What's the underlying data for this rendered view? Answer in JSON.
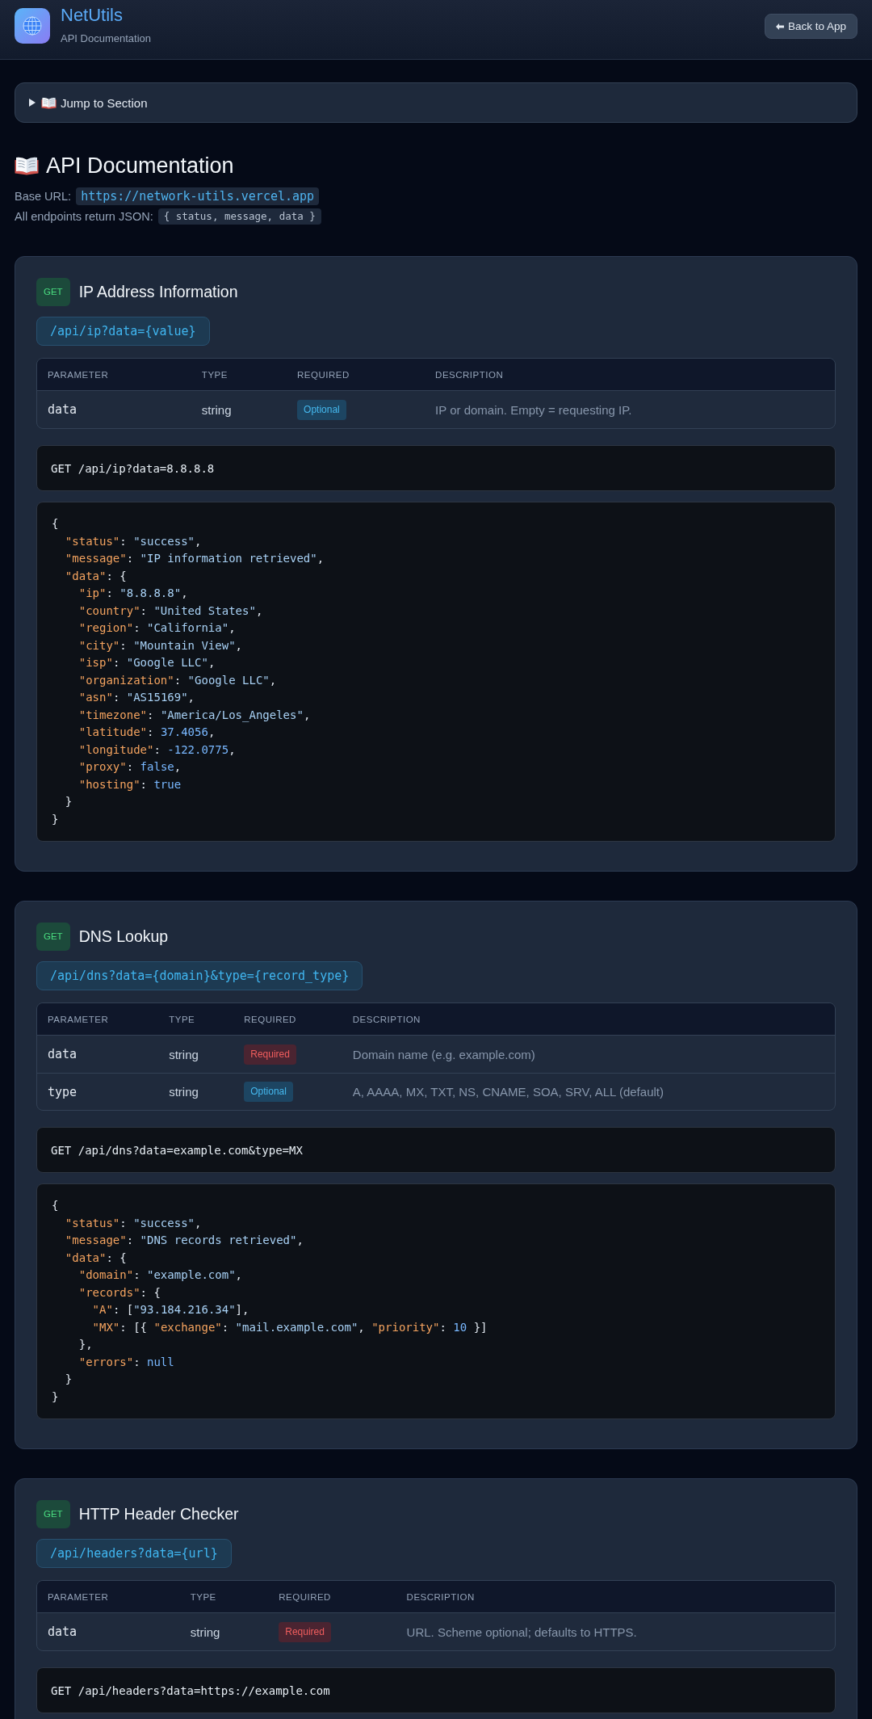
{
  "header": {
    "title": "NetUtils",
    "subtitle": "API Documentation",
    "back_button": "Back to App"
  },
  "jump_to_section": {
    "label": "Jump to Section",
    "expanded": false
  },
  "intro": {
    "title": "API Documentation",
    "base_url_label": "Base URL:",
    "base_url": "https://network-utils.vercel.app",
    "json_note_label": "All endpoints return JSON:",
    "json_shape": "{ status, message, data }"
  },
  "endpoints": [
    {
      "method": "GET",
      "title": "IP Address Information",
      "path": "/api/ip?data={value}",
      "params_table": {
        "columns": [
          "PARAMETER",
          "TYPE",
          "REQUIRED",
          "DESCRIPTION"
        ],
        "rows": [
          {
            "name": "data",
            "type": "string",
            "required": false,
            "badge": "Optional",
            "description": "IP or domain. Empty = requesting IP."
          }
        ]
      },
      "example_request": "GET /api/ip?data=8.8.8.8",
      "example_response": [
        "{",
        "  \"status\": \"success\",",
        "  \"message\": \"IP information retrieved\",",
        "  \"data\": {",
        "    \"ip\": \"8.8.8.8\",",
        "    \"country\": \"United States\",",
        "    \"region\": \"California\",",
        "    \"city\": \"Mountain View\",",
        "    \"isp\": \"Google LLC\",",
        "    \"organization\": \"Google LLC\",",
        "    \"asn\": \"AS15169\",",
        "    \"timezone\": \"America/Los_Angeles\",",
        "    \"latitude\": 37.4056,",
        "    \"longitude\": -122.0775,",
        "    \"proxy\": false,",
        "    \"hosting\": true",
        "  }",
        "}"
      ]
    },
    {
      "method": "GET",
      "title": "DNS Lookup",
      "path": "/api/dns?data={domain}&type={record_type}",
      "params_table": {
        "columns": [
          "PARAMETER",
          "TYPE",
          "REQUIRED",
          "DESCRIPTION"
        ],
        "rows": [
          {
            "name": "data",
            "type": "string",
            "required": true,
            "badge": "Required",
            "description": "Domain name (e.g. example.com)"
          },
          {
            "name": "type",
            "type": "string",
            "required": false,
            "badge": "Optional",
            "description": "A, AAAA, MX, TXT, NS, CNAME, SOA, SRV, ALL (default)"
          }
        ]
      },
      "example_request": "GET /api/dns?data=example.com&type=MX",
      "example_response": [
        "{",
        "  \"status\": \"success\",",
        "  \"message\": \"DNS records retrieved\",",
        "  \"data\": {",
        "    \"domain\": \"example.com\",",
        "    \"records\": {",
        "      \"A\": [\"93.184.216.34\"],",
        "      \"MX\": [{ \"exchange\": \"mail.example.com\", \"priority\": 10 }]",
        "    },",
        "    \"errors\": null",
        "  }",
        "}"
      ]
    },
    {
      "method": "GET",
      "title": "HTTP Header Checker",
      "path": "/api/headers?data={url}",
      "params_table": {
        "columns": [
          "PARAMETER",
          "TYPE",
          "REQUIRED",
          "DESCRIPTION"
        ],
        "rows": [
          {
            "name": "data",
            "type": "string",
            "required": true,
            "badge": "Required",
            "description": "URL. Scheme optional; defaults to HTTPS."
          }
        ]
      },
      "example_request": "GET /api/headers?data=https://example.com"
    }
  ]
}
